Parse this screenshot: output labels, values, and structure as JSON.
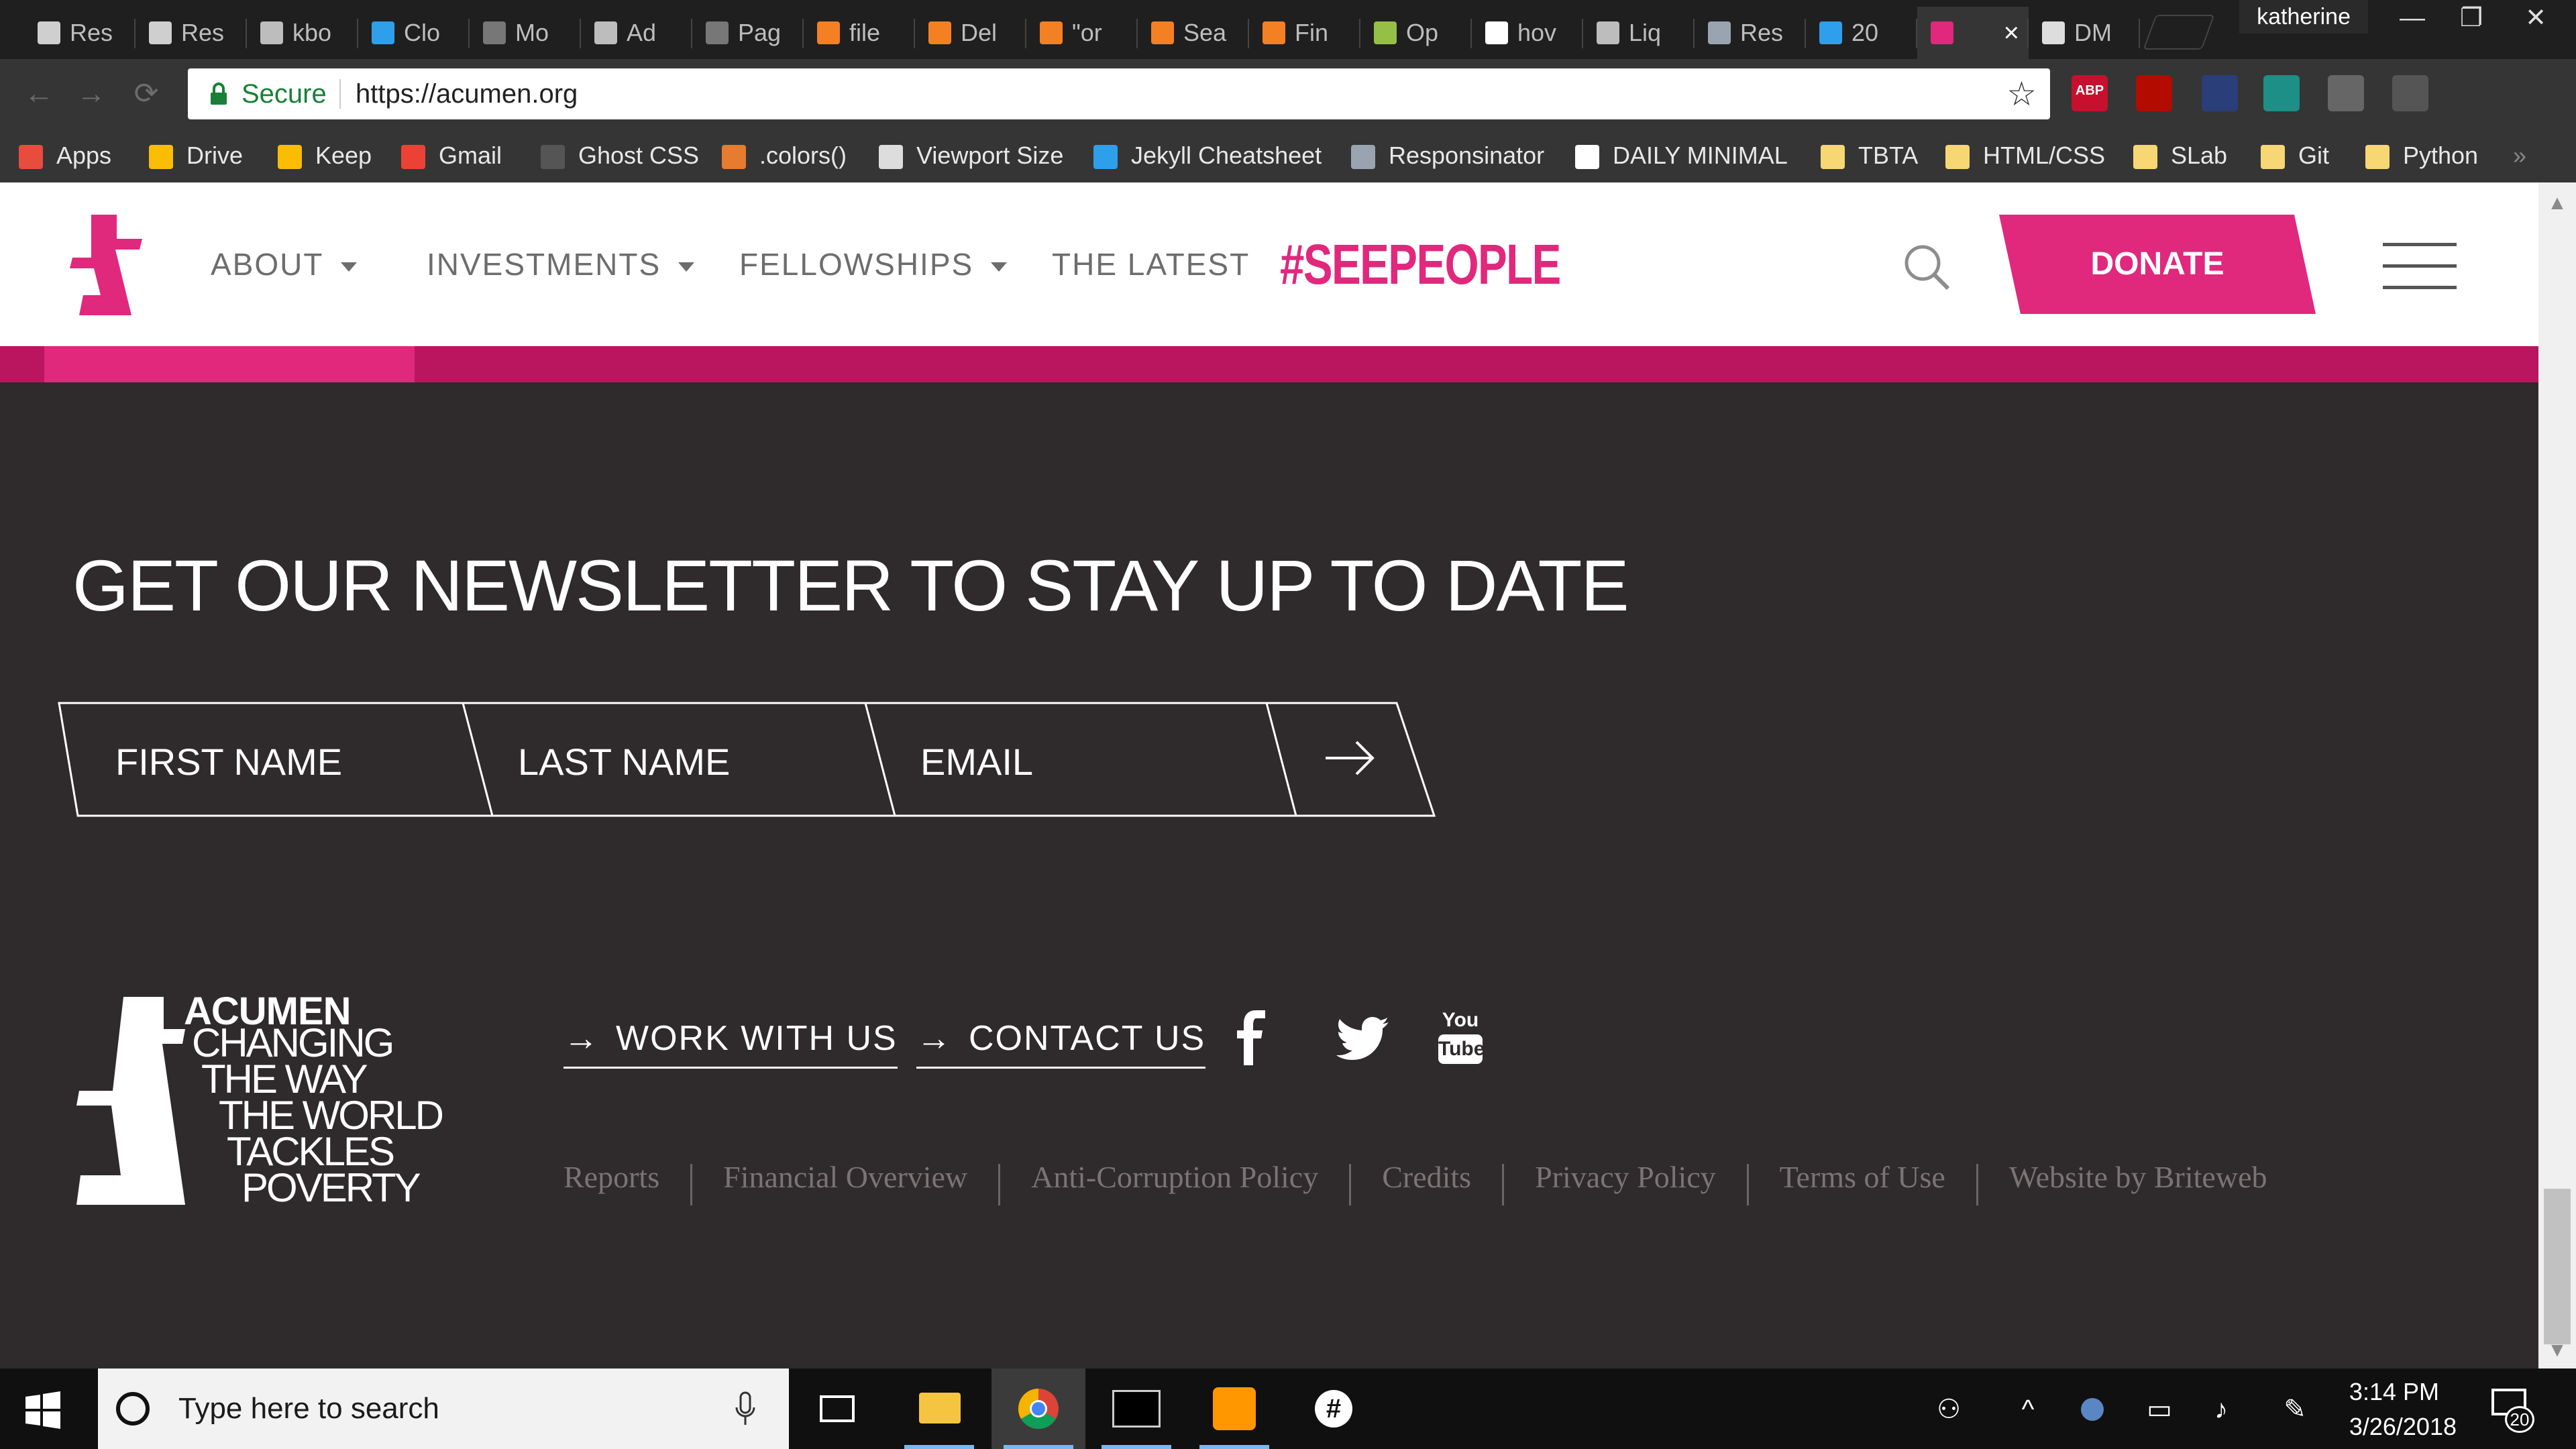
{
  "browser": {
    "tabs": [
      {
        "title": "Res",
        "icon": "document-icon",
        "color": "#cfcfcf"
      },
      {
        "title": "Res",
        "icon": "document-icon",
        "color": "#cfcfcf"
      },
      {
        "title": "kbo",
        "icon": "github-icon",
        "color": "#bdbdbd"
      },
      {
        "title": "Clo",
        "icon": "cloud9-icon",
        "color": "#2e9fea"
      },
      {
        "title": "Mo",
        "icon": "graph-icon",
        "color": "#777"
      },
      {
        "title": "Ad",
        "icon": "github-icon",
        "color": "#bdbdbd"
      },
      {
        "title": "Pag",
        "icon": "graph-icon",
        "color": "#777"
      },
      {
        "title": "file",
        "icon": "stackoverflow-icon",
        "color": "#f48024"
      },
      {
        "title": "Del",
        "icon": "stackoverflow-icon",
        "color": "#f48024"
      },
      {
        "title": "\"or",
        "icon": "stackoverflow-icon",
        "color": "#f48024"
      },
      {
        "title": "Sea",
        "icon": "stackoverflow-icon",
        "color": "#f48024"
      },
      {
        "title": "Fin",
        "icon": "stackoverflow-icon",
        "color": "#f48024"
      },
      {
        "title": "Op",
        "icon": "shopify-icon",
        "color": "#95bf47"
      },
      {
        "title": "hov",
        "icon": "google-icon",
        "color": "#ffffff"
      },
      {
        "title": "Liq",
        "icon": "github-icon",
        "color": "#bdbdbd"
      },
      {
        "title": "Res",
        "icon": "r-icon",
        "color": "#9aa4b0"
      },
      {
        "title": "20",
        "icon": "top-icon",
        "color": "#2e9fea"
      },
      {
        "title": "",
        "icon": "acumen-icon",
        "color": "#e0287d",
        "active": true
      },
      {
        "title": "DM",
        "icon": "dm-icon",
        "color": "#ddd"
      }
    ],
    "active_close": "×",
    "user": "katherine",
    "window_controls": [
      "—",
      "❐",
      "✕"
    ],
    "secure_label": "Secure",
    "url": "https://acumen.org",
    "bookmarks": [
      {
        "label": "Apps",
        "icon": "apps-grid-icon",
        "color": "#e74c3c"
      },
      {
        "label": "Drive",
        "icon": "drive-icon",
        "color": "#fbbc04"
      },
      {
        "label": "Keep",
        "icon": "keep-icon",
        "color": "#fbbc04"
      },
      {
        "label": "Gmail",
        "icon": "gmail-icon",
        "color": "#ea4335"
      },
      {
        "label": "Ghost CSS",
        "icon": "document-icon",
        "color": "#555"
      },
      {
        "label": ".colors()",
        "icon": "palette-icon",
        "color": "#e57c2f"
      },
      {
        "label": "Viewport Size",
        "icon": "viewport-icon",
        "color": "#ddd"
      },
      {
        "label": "Jekyll Cheatsheet",
        "icon": "cloud9-icon",
        "color": "#2e9fea"
      },
      {
        "label": "Responsinator",
        "icon": "r-icon",
        "color": "#9aa4b0"
      },
      {
        "label": "DAILY MINIMAL",
        "icon": "dm-icon",
        "color": "#fff"
      },
      {
        "label": "TBTA",
        "icon": "folder-icon",
        "color": "#f7d774"
      },
      {
        "label": "HTML/CSS",
        "icon": "folder-icon",
        "color": "#f7d774"
      },
      {
        "label": "SLab",
        "icon": "folder-icon",
        "color": "#f7d774"
      },
      {
        "label": "Git",
        "icon": "folder-icon",
        "color": "#f7d774"
      },
      {
        "label": "Python",
        "icon": "folder-icon",
        "color": "#f7d774"
      }
    ],
    "bookmarks_overflow": "»"
  },
  "site": {
    "nav": {
      "about": "ABOUT",
      "investments": "INVESTMENTS",
      "fellowships": "FELLOWSHIPS",
      "latest": "THE LATEST",
      "seepeople": "#SEEPEOPLE"
    },
    "donate": "DONATE",
    "accent": "#e0287d",
    "band_color": "#b9165f",
    "newsletter": {
      "title": "GET OUR NEWSLETTER TO STAY UP TO DATE",
      "first_name_placeholder": "FIRST NAME",
      "last_name_placeholder": "LAST NAME",
      "email_placeholder": "EMAIL"
    },
    "footer": {
      "brand": "ACUMEN",
      "tagline": [
        "CHANGING",
        "THE WAY",
        "THE WORLD",
        "TACKLES",
        "POVERTY"
      ],
      "work_with_us": "WORK WITH US",
      "contact_us": "CONTACT US",
      "social": [
        "facebook-icon",
        "twitter-icon",
        "youtube-icon"
      ],
      "youtube_text_top": "You",
      "youtube_text_bottom": "Tube",
      "legal": [
        "Reports",
        "Financial Overview",
        "Anti-Corruption Policy",
        "Credits",
        "Privacy Policy",
        "Terms of Use",
        "Website by Briteweb"
      ]
    }
  },
  "taskbar": {
    "search_placeholder": "Type here to search",
    "time": "3:14 PM",
    "date": "3/26/2018",
    "notification_count": "20"
  }
}
